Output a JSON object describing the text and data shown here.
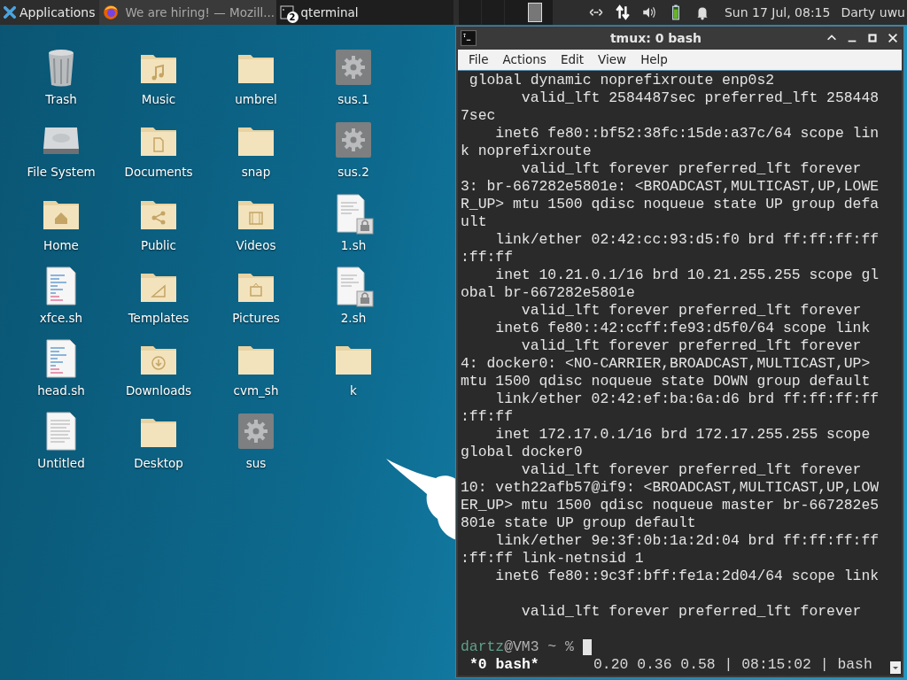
{
  "panel": {
    "menu_label": "Applications",
    "tasks": [
      {
        "label": "We are hiring! — Mozill...",
        "kind": "browser",
        "selected": false
      },
      {
        "label": "qterminal",
        "kind": "terminal",
        "selected": true,
        "badge": "2"
      }
    ],
    "clock": "Sun 17 Jul, 08:15",
    "user": "Darty uwu"
  },
  "desktop_icons": [
    {
      "label": "Trash",
      "kind": "trash"
    },
    {
      "label": "File System",
      "kind": "drive"
    },
    {
      "label": "Home",
      "kind": "home"
    },
    {
      "label": "xfce.sh",
      "kind": "script"
    },
    {
      "label": "head.sh",
      "kind": "script"
    },
    {
      "label": "Untitled",
      "kind": "text"
    },
    {
      "label": "Music",
      "kind": "music"
    },
    {
      "label": "Documents",
      "kind": "document"
    },
    {
      "label": "Public",
      "kind": "share"
    },
    {
      "label": "Templates",
      "kind": "template"
    },
    {
      "label": "Downloads",
      "kind": "download"
    },
    {
      "label": "Desktop",
      "kind": "folder"
    },
    {
      "label": "umbrel",
      "kind": "folder"
    },
    {
      "label": "snap",
      "kind": "folder"
    },
    {
      "label": "Videos",
      "kind": "video"
    },
    {
      "label": "Pictures",
      "kind": "picture"
    },
    {
      "label": "cvm_sh",
      "kind": "folder"
    },
    {
      "label": "sus",
      "kind": "gear"
    },
    {
      "label": "sus.1",
      "kind": "gear"
    },
    {
      "label": "sus.2",
      "kind": "gear"
    },
    {
      "label": "1.sh",
      "kind": "locked"
    },
    {
      "label": "2.sh",
      "kind": "locked"
    },
    {
      "label": "k",
      "kind": "folder"
    }
  ],
  "terminal": {
    "title": "tmux: 0 bash",
    "menu": [
      "File",
      "Actions",
      "Edit",
      "View",
      "Help"
    ],
    "lines": [
      {
        "text": " global dynamic noprefixroute enp0s2"
      },
      {
        "text": "       valid_lft 2584487sec preferred_lft 258448"
      },
      {
        "text": "7sec"
      },
      {
        "text": "    inet6 fe80::bf52:38fc:15de:a37c/64 scope lin"
      },
      {
        "text": "k noprefixroute"
      },
      {
        "text": "       valid_lft forever preferred_lft forever"
      },
      {
        "text": "3: br-667282e5801e: <BROADCAST,MULTICAST,UP,LOWE"
      },
      {
        "text": "R_UP> mtu 1500 qdisc noqueue state UP group defa"
      },
      {
        "text": "ult"
      },
      {
        "text": "    link/ether 02:42:cc:93:d5:f0 brd ff:ff:ff:ff"
      },
      {
        "text": ":ff:ff"
      },
      {
        "text": "    inet 10.21.0.1/16 brd 10.21.255.255 scope gl"
      },
      {
        "text": "obal br-667282e5801e"
      },
      {
        "text": "       valid_lft forever preferred_lft forever"
      },
      {
        "text": "    inet6 fe80::42:ccff:fe93:d5f0/64 scope link"
      },
      {
        "text": "       valid_lft forever preferred_lft forever"
      },
      {
        "text": "4: docker0: <NO-CARRIER,BROADCAST,MULTICAST,UP>"
      },
      {
        "text": "mtu 1500 qdisc noqueue state DOWN group default"
      },
      {
        "text": "    link/ether 02:42:ef:ba:6a:d6 brd ff:ff:ff:ff"
      },
      {
        "text": ":ff:ff"
      },
      {
        "text": "    inet 172.17.0.1/16 brd 172.17.255.255 scope"
      },
      {
        "text": "global docker0"
      },
      {
        "text": "       valid_lft forever preferred_lft forever"
      },
      {
        "text": "10: veth22afb57@if9: <BROADCAST,MULTICAST,UP,LOW"
      },
      {
        "text": "ER_UP> mtu 1500 qdisc noqueue master br-667282e5"
      },
      {
        "text": "801e state UP group default"
      },
      {
        "text": "    link/ether 9e:3f:0b:1a:2d:04 brd ff:ff:ff:ff"
      },
      {
        "text": ":ff:ff link-netnsid 1"
      },
      {
        "text": "    inet6 fe80::9c3f:bff:fe1a:2d04/64 scope link"
      }
    ],
    "lines_after_blank": [
      {
        "text": "       valid_lft forever preferred_lft forever"
      }
    ],
    "prompt": {
      "user": "dartz",
      "rest": "@VM3 ~ %"
    },
    "status": {
      "window": "*0 bash*",
      "info": "0.20 0.36 0.58 | 08:15:02 | bash"
    }
  }
}
